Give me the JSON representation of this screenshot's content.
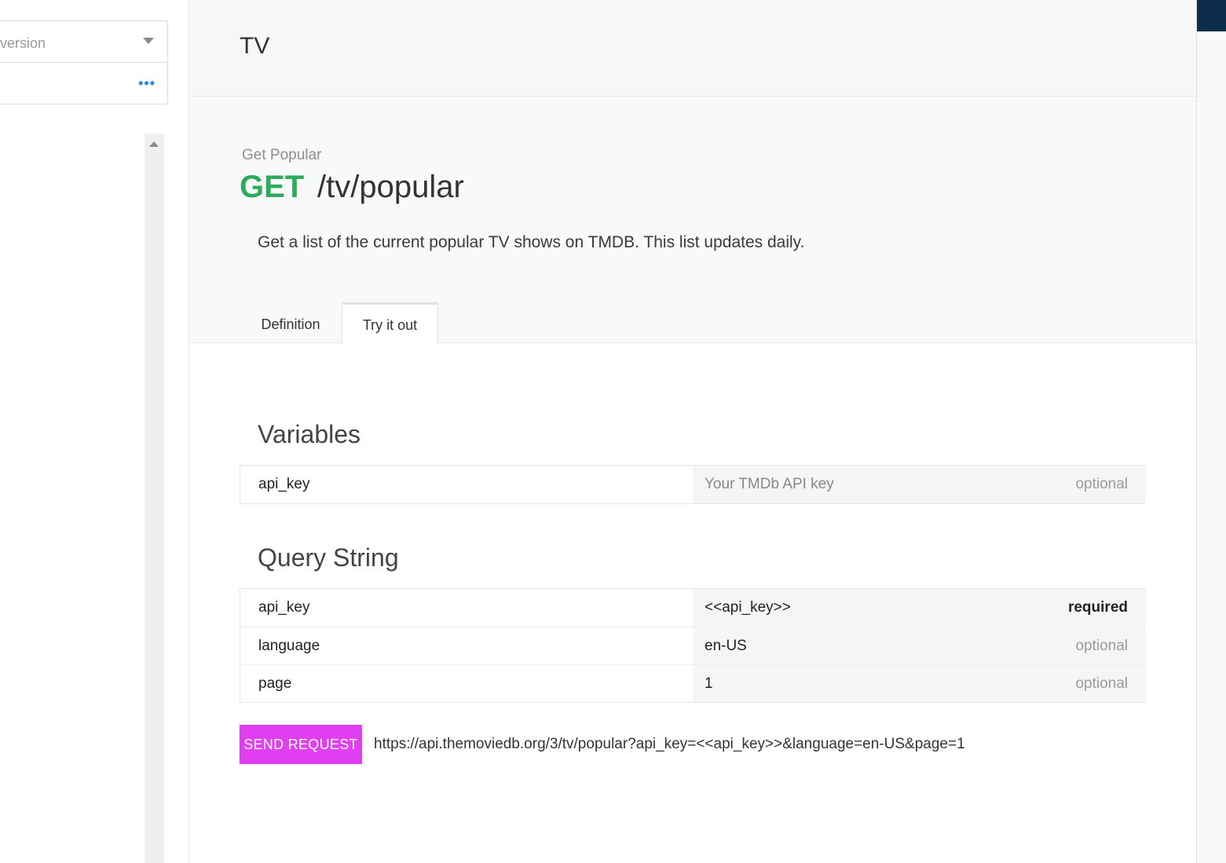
{
  "sidebar": {
    "version_select": {
      "label": "version"
    },
    "search_more_label": "•••"
  },
  "header": {
    "title": "TV"
  },
  "endpoint": {
    "subtitle": "Get Popular",
    "method": "GET",
    "path": "/tv/popular",
    "description": "Get a list of the current popular TV shows on TMDB. This list updates daily."
  },
  "tabs": [
    {
      "label": "Definition",
      "active": false
    },
    {
      "label": "Try it out",
      "active": true
    }
  ],
  "variables": {
    "title": "Variables",
    "rows": [
      {
        "name": "api_key",
        "value": "",
        "placeholder": "Your TMDb API key",
        "requirement": "optional"
      }
    ]
  },
  "query_string": {
    "title": "Query String",
    "rows": [
      {
        "name": "api_key",
        "value": "<<api_key>>",
        "requirement": "required"
      },
      {
        "name": "language",
        "value": "en-US",
        "requirement": "optional"
      },
      {
        "name": "page",
        "value": "1",
        "requirement": "optional"
      }
    ]
  },
  "request": {
    "button_label": "SEND REQUEST",
    "url": "https://api.themoviedb.org/3/tv/popular?api_key=<<api_key>>&language=en-US&page=1"
  },
  "colors": {
    "method_get": "#2eaa5c",
    "send_button": "#e03ef0",
    "accent_dark": "#0d2e4a",
    "more_dots": "#2a8ae8"
  }
}
